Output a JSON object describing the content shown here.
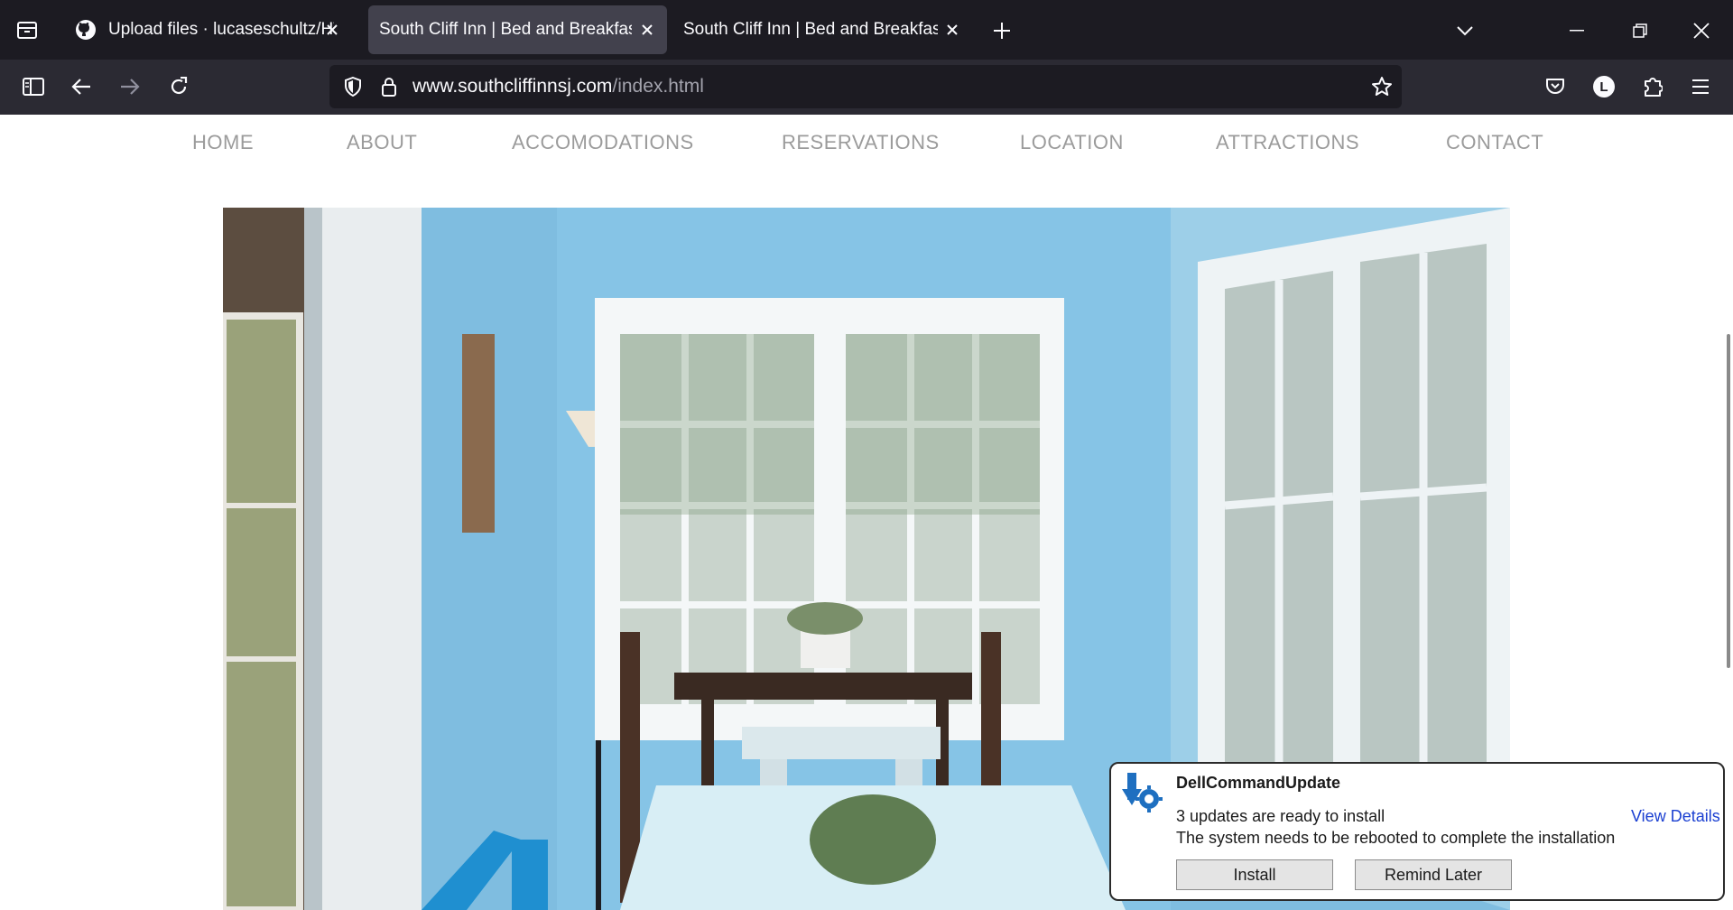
{
  "browser": {
    "tabs": [
      {
        "label": "Upload files · lucaseschultz/HTT",
        "active": false
      },
      {
        "label": "South Cliff Inn | Bed and Breakfast |",
        "active": true
      },
      {
        "label": "South Cliff Inn | Bed and Breakfast |",
        "active": false
      }
    ],
    "url": {
      "domain": "www.southcliffinnsj.com",
      "path": "/index.html"
    },
    "account_initial": "L"
  },
  "site": {
    "nav": [
      "HOME",
      "ABOUT",
      "ACCOMODATIONS",
      "RESERVATIONS",
      "LOCATION",
      "ATTRACTIONS",
      "CONTACT"
    ]
  },
  "notification": {
    "app": "DellCommandUpdate",
    "line1": "3 updates are ready to install",
    "line2": "The system needs to be rebooted to complete the installation",
    "view_details": "View Details",
    "install_label": "Install",
    "remind_label": "Remind Later"
  },
  "colors": {
    "tab_bg": "#1c1b22",
    "toolbar_bg": "#2b2a33",
    "nav_text": "#9b9b9b",
    "link": "#1a3fd1"
  }
}
